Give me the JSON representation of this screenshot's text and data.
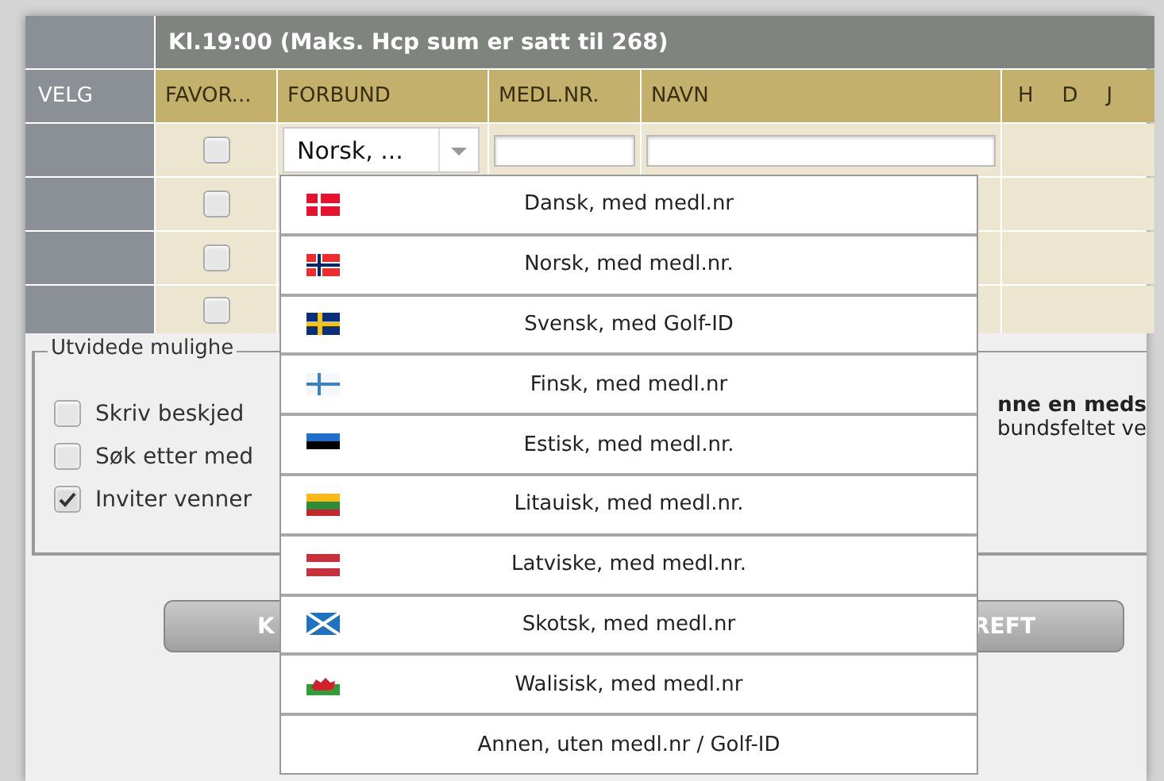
{
  "title": "Kl.19:00 (Maks. Hcp sum er satt til 268)",
  "columns": {
    "velg": "VELG",
    "favorite": "FAVOR...",
    "federation": "FORBUND",
    "member_no": "MEDL.NR.",
    "name": "NAVN",
    "h": "H",
    "d": "D",
    "j": "J"
  },
  "rows": [
    {
      "favorite_checked": false,
      "federation": "Norsk, ..."
    },
    {
      "favorite_checked": false
    },
    {
      "favorite_checked": false
    },
    {
      "favorite_checked": false
    }
  ],
  "options": {
    "legend": "Utvidede mulighe",
    "items": [
      {
        "label": "Skriv beskjed",
        "checked": false
      },
      {
        "label": "Søk etter med",
        "checked": false
      },
      {
        "label": "Inviter venner",
        "checked": true
      }
    ],
    "note_bold": "nne en meds",
    "note": "bundsfeltet ve"
  },
  "buttons": [
    {
      "label": "K"
    },
    {
      "label": "REFT"
    }
  ],
  "dropdown": [
    {
      "kind": "dk",
      "label": "Dansk, med medl.nr",
      "selected": false
    },
    {
      "kind": "no",
      "label": "Norsk, med medl.nr.",
      "selected": false
    },
    {
      "kind": "se",
      "label": "Svensk, med Golf-ID",
      "selected": false
    },
    {
      "kind": "fi",
      "label": "Finsk, med medl.nr",
      "selected": false
    },
    {
      "kind": "ee",
      "label": "Estisk, med medl.nr.",
      "selected": false
    },
    {
      "kind": "lt",
      "label": "Litauisk, med medl.nr.",
      "selected": false
    },
    {
      "kind": "lv",
      "label": "Latviske, med medl.nr.",
      "selected": false
    },
    {
      "kind": "sco",
      "label": "Skotsk, med medl.nr",
      "selected": false
    },
    {
      "kind": "wal",
      "label": "Walisisk, med medl.nr",
      "selected": false
    },
    {
      "kind": "none",
      "label": "Annen, uten medl.nr / Golf-ID",
      "selected": false
    }
  ]
}
